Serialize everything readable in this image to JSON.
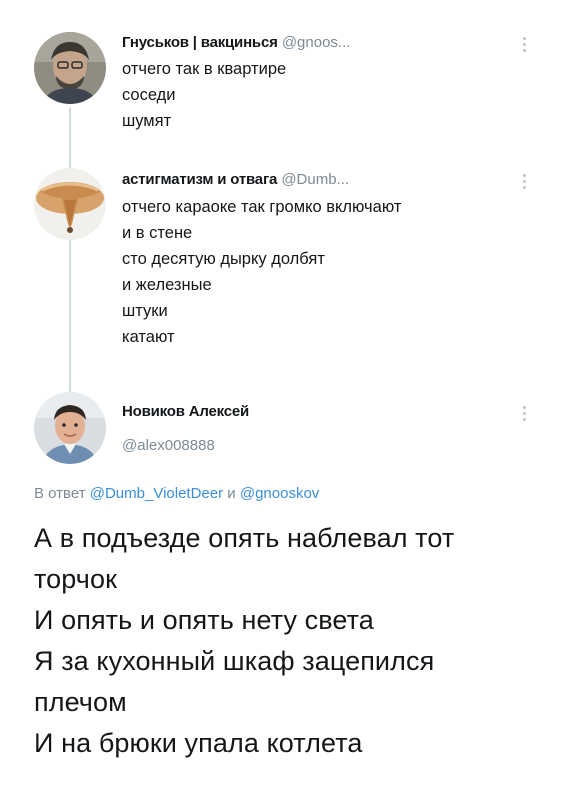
{
  "tweets": [
    {
      "name": "Гнуськов | вакциньcя",
      "handle": "@gnoos...",
      "lines": [
        "отчего так в квартире",
        "соседи",
        "шумят"
      ]
    },
    {
      "name": "астигматизм и отвага",
      "handle": "@Dumb...",
      "lines": [
        "отчего караоке так громко включают",
        "и в стене",
        "сто десятую дырку долбят",
        "и железные",
        "штуки",
        "катают"
      ]
    }
  ],
  "main_tweet": {
    "name": "Новиков Алексей",
    "handle": "@alex008888",
    "reply_prefix": "В ответ",
    "reply_mention_1": "@Dumb_VioletDeer",
    "reply_and": "и",
    "reply_mention_2": "@gnooskov",
    "lines": [
      "А в подъезде опять наблевал тот",
      "торчок",
      "И опять и опять нету света",
      "Я за кухонный шкаф зацепился",
      "плечом",
      "И на брюки упала котлета"
    ]
  },
  "icons": {
    "more": "more-vertical-icon"
  },
  "colors": {
    "text": "#14171a",
    "muted": "#7b8a96",
    "link": "#3a8fd8",
    "thread_line": "#cfd9de"
  }
}
